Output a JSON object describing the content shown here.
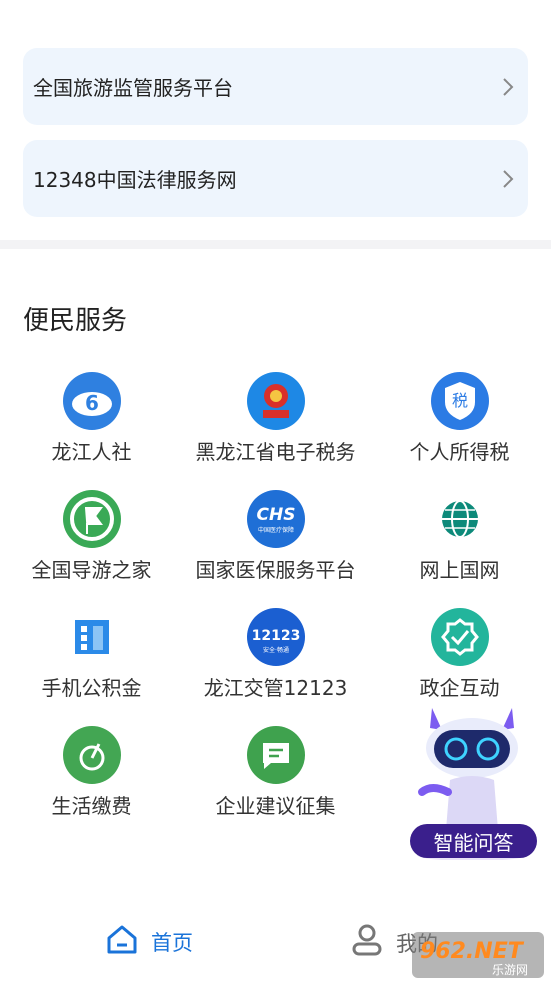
{
  "links": [
    {
      "label": "全国旅游监管服务平台"
    },
    {
      "label": "12348中国法律服务网"
    }
  ],
  "section": {
    "title": "便民服务"
  },
  "services": [
    {
      "label": "龙江人社",
      "icon": "longjiang-hrss-icon",
      "color": "#2f80e0"
    },
    {
      "label": "黑龙江省电子税务",
      "icon": "tax-emblem-icon",
      "color": "#1e88e5"
    },
    {
      "label": "个人所得税",
      "icon": "income-tax-shield-icon",
      "color": "#2b7be4"
    },
    {
      "label": "全国导游之家",
      "icon": "tour-guide-flag-icon",
      "color": "#3aa956"
    },
    {
      "label": "国家医保服务平台",
      "icon": "chs-medical-insurance-icon",
      "color": "#1f6fd6"
    },
    {
      "label": "网上国网",
      "icon": "state-grid-globe-icon",
      "color": "#0d8a7a"
    },
    {
      "label": "手机公积金",
      "icon": "housing-fund-building-icon",
      "color": "#2b8ae8"
    },
    {
      "label": "龙江交管12123",
      "icon": "traffic-12123-icon",
      "color": "#1b5fd1"
    },
    {
      "label": "政企互动",
      "icon": "gov-enterprise-check-icon",
      "color": "#23b59c"
    },
    {
      "label": "生活缴费",
      "icon": "utility-payment-leaf-icon",
      "color": "#43a653"
    },
    {
      "label": "企业建议征集",
      "icon": "suggestion-chat-icon",
      "color": "#3fa24e"
    }
  ],
  "assistant": {
    "label": "智能问答"
  },
  "tabbar": {
    "home": "首页",
    "me": "我的"
  },
  "icon_text": {
    "traffic": "12123",
    "traffic_sub": "安全·畅通",
    "chs": "CHS",
    "chs_sub": "中国医疗保障",
    "tax": "税"
  },
  "watermark": {
    "text": "962.NET",
    "sub": "乐游网"
  }
}
